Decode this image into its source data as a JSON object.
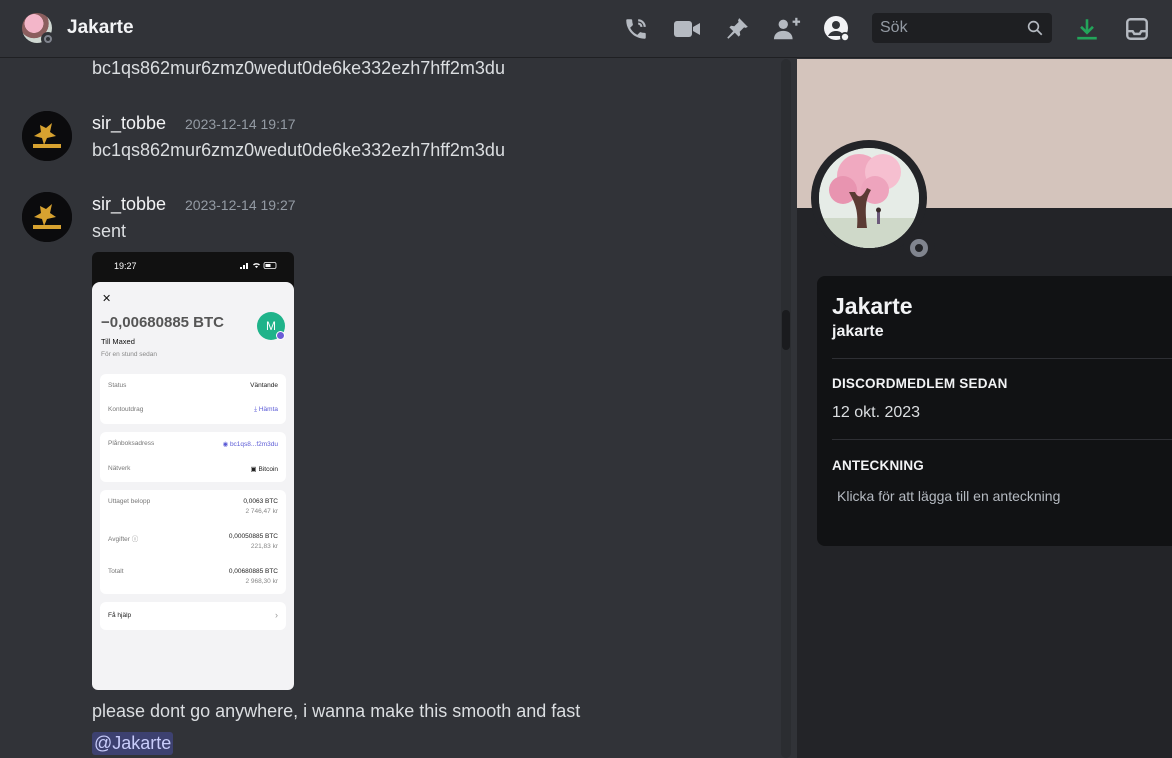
{
  "header": {
    "title": "Jakarte",
    "search_placeholder": "Sök"
  },
  "icons": {
    "call": "phone-call-icon",
    "video": "video-camera-icon",
    "pin": "pin-icon",
    "add_friend": "add-friend-icon",
    "profile_toggle": "user-profile-icon",
    "search": "search-icon",
    "download": "download-icon",
    "inbox": "inbox-icon"
  },
  "colors": {
    "download": "#23a55a",
    "mention_bg": "#3c4270",
    "mention_text": "#c9cdfb"
  },
  "messages": {
    "top_line": "bc1qs862mur6zmz0wedut0de6ke332ezh7hff2m3du",
    "m1": {
      "author": "sir_tobbe",
      "time": "2023-12-14 19:17",
      "text": "bc1qs862mur6zmz0wedut0de6ke332ezh7hff2m3du"
    },
    "m2": {
      "author": "sir_tobbe",
      "time": "2023-12-14 19:27",
      "text": "sent"
    },
    "followup": "please dont go anywhere, i wanna make this smooth and fast",
    "mention": "@Jakarte"
  },
  "attachment": {
    "clock": "19:27",
    "close": "✕",
    "amount": "−0,00680885 BTC",
    "to": "Till Maxed",
    "ago": "För en stund sedan",
    "badge": "M",
    "status_label": "Status",
    "status_value": "Väntande",
    "statement_label": "Kontoutdrag",
    "statement_value": "Hämta",
    "address_label": "Plånboksadress",
    "address_value": "bc1qs8...f2m3du",
    "network_label": "Nätverk",
    "network_value": "Bitcoin",
    "withdrawn_label": "Uttaget belopp",
    "withdrawn_value": "0,0063 BTC",
    "withdrawn_sub": "2 746,47 kr",
    "fees_label": "Avgifter",
    "fees_value": "0,00050885 BTC",
    "fees_sub": "221,83 kr",
    "total_label": "Totalt",
    "total_value": "0,00680885 BTC",
    "total_sub": "2 968,30 kr",
    "help_label": "Få hjälp",
    "help_chevron": "›"
  },
  "profile": {
    "display_name": "Jakarte",
    "username": "jakarte",
    "member_since_label": "DISCORDMEDLEM SEDAN",
    "member_since_value": "12 okt. 2023",
    "note_label": "ANTECKNING",
    "note_placeholder": "Klicka för att lägga till en anteckning"
  }
}
